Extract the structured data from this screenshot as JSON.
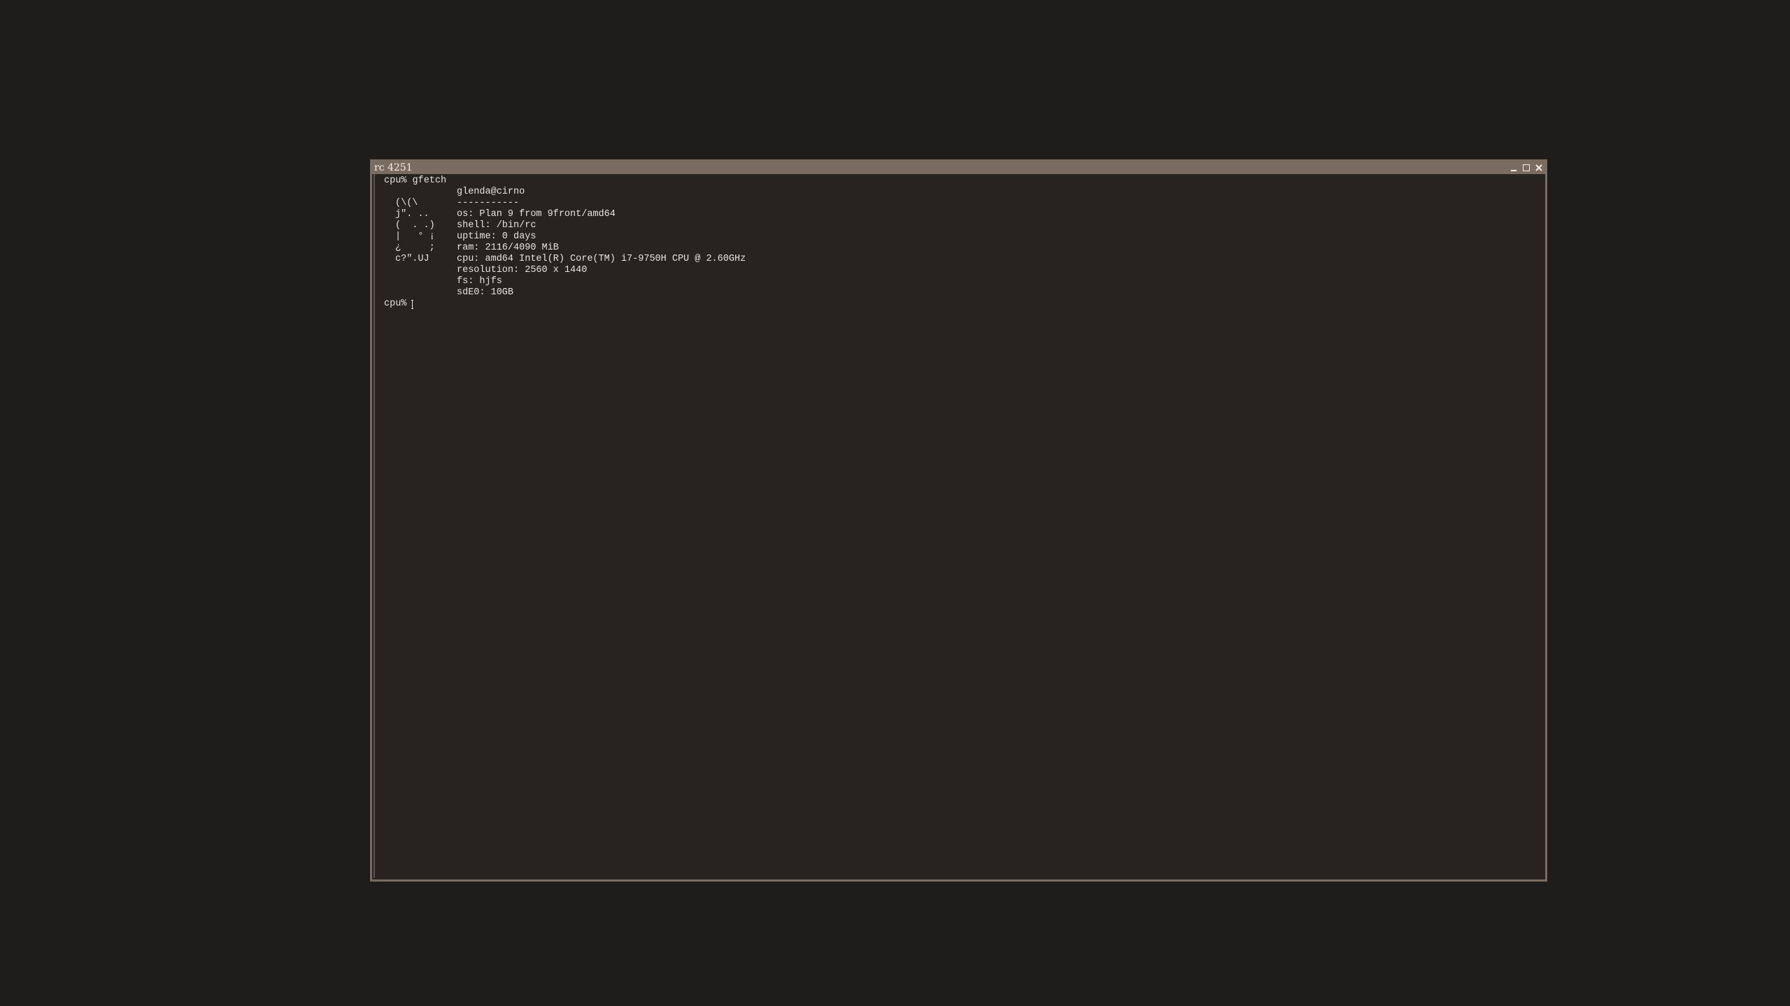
{
  "window": {
    "title": "rc 4251",
    "icons": [
      "minimize-icon",
      "maximize-icon",
      "close-icon"
    ]
  },
  "terminal": {
    "command_line": "cpu% gfetch",
    "logo_lines": [
      "(\\(\\",
      "j\". ..",
      "(  . .)",
      "|   ° ¡",
      "¿     ;",
      "c?\".UJ"
    ],
    "info_lines": [
      "glenda@cirno",
      "-----------",
      "os: Plan 9 from 9front/amd64",
      "shell: /bin/rc",
      "uptime: 0 days",
      "ram: 2116/4090 MiB",
      "cpu: amd64 Intel(R) Core(TM) i7-9750H CPU @ 2.60GHz",
      "resolution: 2560 x 1440",
      "fs: hjfs",
      "sdE0: 10GB"
    ],
    "prompt": "cpu%"
  },
  "colors": {
    "desktop": "#1e1d1b",
    "window_bg": "#262320",
    "border": "#7b6c62",
    "text": "#e8e3dc"
  }
}
